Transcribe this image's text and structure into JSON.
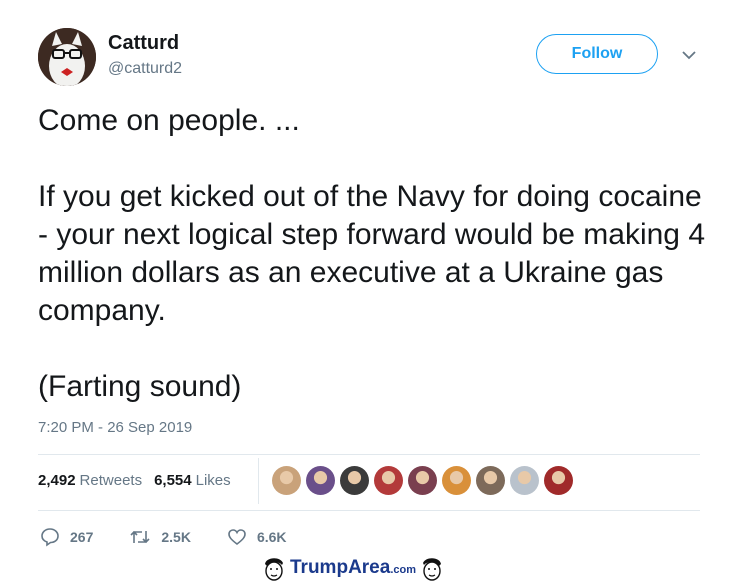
{
  "user": {
    "name": "Catturd",
    "handle": "@catturd2"
  },
  "follow_label": "Follow",
  "tweet": {
    "paragraphs": [
      "Come on people. ...",
      "If you get kicked out of the Navy for doing cocaine - your next logical step forward would be making 4 million dollars as an executive at a Ukraine gas company.",
      "(Farting sound)"
    ],
    "timestamp": "7:20 PM - 26 Sep 2019"
  },
  "stats": {
    "retweets_count": "2,492",
    "retweets_label": "Retweets",
    "likes_count": "6,554",
    "likes_label": "Likes"
  },
  "liker_avatars": [
    {
      "color": "#c9a27a"
    },
    {
      "color": "#6a4f8a"
    },
    {
      "color": "#3b3b3b"
    },
    {
      "color": "#b33a3a"
    },
    {
      "color": "#7a3f4f"
    },
    {
      "color": "#d9903a"
    },
    {
      "color": "#7d6a5a"
    },
    {
      "color": "#b9c2cc"
    },
    {
      "color": "#a02a2a"
    }
  ],
  "actions": {
    "replies": "267",
    "retweets": "2.5K",
    "likes": "6.6K"
  },
  "watermark": {
    "brand_a": "Trump",
    "brand_b": "Area",
    "suffix": ".com"
  },
  "colors": {
    "accent": "#1da1f2",
    "secondary": "#657786",
    "text": "#14171a"
  }
}
